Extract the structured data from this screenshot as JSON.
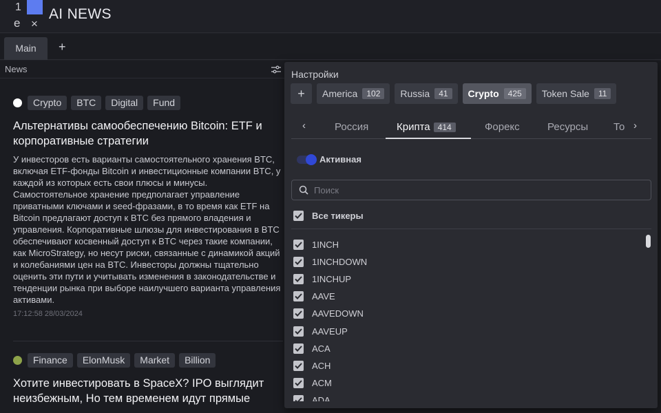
{
  "window": {
    "title": "AI NEWS",
    "tb_num": "1",
    "tb_e": "e",
    "close": "×"
  },
  "tabs": {
    "main": "Main",
    "add": "+"
  },
  "news": {
    "header": "News",
    "items": [
      {
        "dot_color": "#ffffff",
        "tags": [
          "Crypto",
          "BTC",
          "Digital",
          "Fund"
        ],
        "headline": "Альтернативы самообеспечению Bitcoin: ETF и корпоративные стратегии",
        "body": "У инвесторов есть варианты самостоятельного хранения BTC, включая ETF-фонды Bitcoin и инвестиционные компании BTC, у каждой из которых есть свои плюсы и минусы. Самостоятельное хранение предполагает управление приватными ключами и seed-фразами, в то время как ETF на Bitcoin предлагают доступ к BTC без прямого владения и управления. Корпоративные шлюзы для инвестирования в BTC обеспечивают косвенный доступ к BTC через такие компании, как MicroStrategy, но несут риски, связанные с динамикой акций и колебаниями цен на BTC. Инвесторы должны тщательно оценить эти пути и учитывать изменения в законодательстве и тенденции рынка при выборе наилучшего варианта управления активами.",
        "timestamp": "17:12:58 28/03/2024"
      },
      {
        "dot_color": "#8ea34a",
        "tags": [
          "Finance",
          "ElonMusk",
          "Market",
          "Billion"
        ],
        "headline": "Хотите инвестировать в SpaceX? IPO выглядит неизбежным, Но тем временем идут прямые",
        "body": "",
        "timestamp": ""
      }
    ]
  },
  "settings": {
    "title": "Настройки",
    "add": "+",
    "categories": [
      {
        "label": "America",
        "count": "102"
      },
      {
        "label": "Russia",
        "count": "41"
      },
      {
        "label": "Crypto",
        "count": "425"
      },
      {
        "label": "Token Sale",
        "count": "11"
      }
    ],
    "tabs": [
      {
        "label": "Россия"
      },
      {
        "label": "Крипта",
        "count": "414"
      },
      {
        "label": "Форекс"
      },
      {
        "label": "Ресурсы"
      },
      {
        "label": "То"
      }
    ],
    "arrow_left": "‹",
    "arrow_right": "›",
    "toggle_label": "Активная",
    "search_placeholder": "Поиск",
    "all_label": "Все тикеры",
    "tickers": [
      "1INCH",
      "1INCHDOWN",
      "1INCHUP",
      "AAVE",
      "AAVEDOWN",
      "AAVEUP",
      "ACA",
      "ACH",
      "ACM",
      "ADA"
    ]
  },
  "colors": {
    "accent": "#5d7cf0",
    "toggle": "#3048d6"
  }
}
